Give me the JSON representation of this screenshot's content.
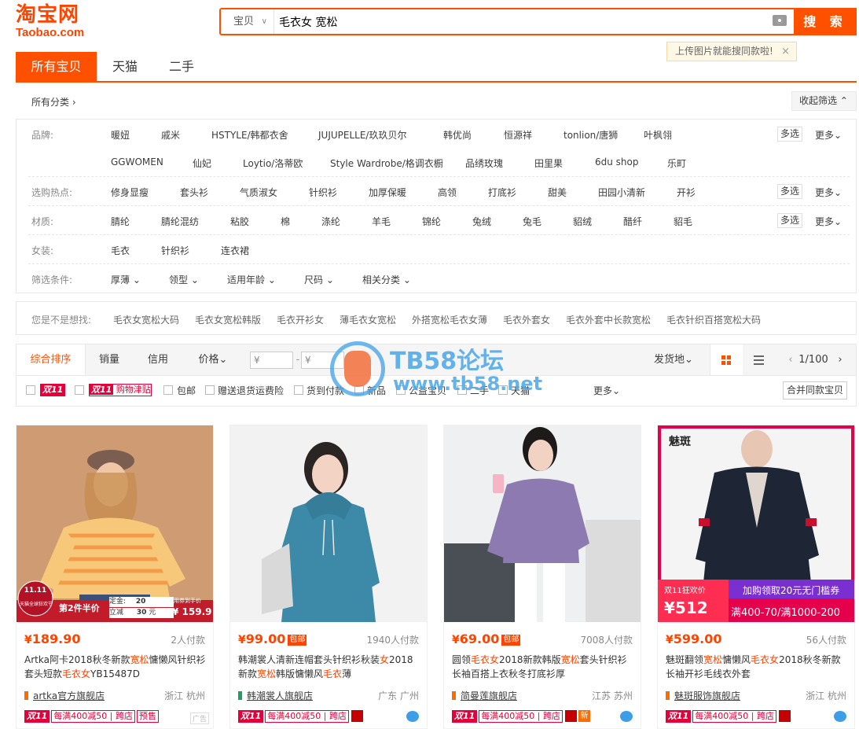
{
  "logo": {
    "cn": "淘宝网",
    "en": "Taobao.com"
  },
  "search": {
    "scope": "宝贝",
    "query": "毛衣女 宽松",
    "button": "搜 索",
    "tip": "上传图片就能搜同款啦!"
  },
  "tabs": [
    "所有宝贝",
    "天猫",
    "二手"
  ],
  "crumb": "所有分类 ›",
  "fold_button": "收起筛选 ⌃",
  "filters": {
    "brand_label": "品牌:",
    "brand_row1": [
      "暖妞",
      "戚米",
      "HSTYLE/韩都衣舍",
      "JUJUPELLE/玖玖贝尔",
      "韩优尚",
      "恒源祥",
      "tonlion/唐狮",
      "叶枫翎"
    ],
    "brand_row2": [
      "GGWOMEN",
      "仙妃",
      "Loytio/洛蒂欧",
      "Style Wardrobe/格调衣橱",
      "品绣玫瑰",
      "田里果",
      "6du shop",
      "乐町"
    ],
    "hot_label": "选购热点:",
    "hot": [
      "修身显瘦",
      "套头衫",
      "气质淑女",
      "针织衫",
      "加厚保暖",
      "高领",
      "打底衫",
      "甜美",
      "田园小清新",
      "开衫"
    ],
    "material_label": "材质:",
    "material": [
      "腈纶",
      "腈纶混纺",
      "粘胶",
      "棉",
      "涤纶",
      "羊毛",
      "锦纶",
      "兔绒",
      "兔毛",
      "貂绒",
      "醋纤",
      "貂毛"
    ],
    "women_label": "女装:",
    "women": [
      "毛衣",
      "针织衫",
      "连衣裙"
    ],
    "cond_label": "筛选条件:",
    "cond": [
      "厚薄 ⌄",
      "领型 ⌄",
      "适用年龄 ⌄",
      "尺码 ⌄",
      "相关分类 ⌄"
    ],
    "multi": "多选",
    "more": "更多⌄"
  },
  "suggest": {
    "label": "您是不是想找:",
    "items": [
      "毛衣女宽松大码",
      "毛衣女宽松韩版",
      "毛衣开衫女",
      "薄毛衣女宽松",
      "外搭宽松毛衣女薄",
      "毛衣外套女",
      "毛衣外套中长款宽松",
      "毛衣针织百搭宽松大码"
    ]
  },
  "sort": {
    "items": [
      "综合排序",
      "销量",
      "信用",
      "价格⌄"
    ],
    "price_from": "¥",
    "price_to": "¥",
    "dash": "-",
    "ship": "发货地⌄",
    "page": "1/100",
    "page_prev": "‹",
    "page_next": "›"
  },
  "checks": {
    "d11": "双11",
    "d11_coupon_tag": "双11",
    "d11_coupon": "购物津贴",
    "labels": [
      "包邮",
      "赠送退货运费险",
      "货到付款",
      "新品",
      "公益宝贝",
      "二手",
      "天猫"
    ],
    "more": "更多⌄",
    "merge": "合并同款宝贝"
  },
  "watermark": {
    "title": "TB58论坛",
    "url": "www.tb58.net"
  },
  "products": [
    {
      "price": "189.90",
      "baoyou": "",
      "deals": "2人付款",
      "title": "Artka阿卡2018秋冬新款宽松慵懒风针织衫套头短款毛衣女YB15487D",
      "shop": "artka官方旗舰店",
      "loc": "浙江 杭州",
      "promo": "每满400减50",
      "badge": "跨店",
      "badge2": "预售",
      "ad": "广告",
      "overlay": {
        "tag": "第2件半价",
        "deposit_label": "定金:",
        "deposit": "20",
        "cut_label": "立减",
        "cut": "30",
        "unit": "元",
        "final_label": "用券到手价",
        "final": "¥ 159.9",
        "seal": "11.11",
        "seal_sub": "天猫全球狂欢节"
      }
    },
    {
      "price": "99.00",
      "baoyou": "包邮",
      "deals": "1940人付款",
      "title": "韩潮裳人清新连帽套头针织衫秋装女2018新款宽松韩版慵懒风毛衣薄",
      "shop": "韩潮裳人旗舰店",
      "loc": "广东 广州",
      "promo": "每满400减50",
      "badge": "跨店"
    },
    {
      "price": "69.00",
      "baoyou": "包邮",
      "deals": "7008人付款",
      "title": "圆领毛衣女2018新款韩版宽松套头针织衫长袖百搭上衣秋冬打底衫厚",
      "shop": "简曼莲旗舰店",
      "loc": "江苏 苏州",
      "promo": "每满400减50",
      "badge": "跨店",
      "xin": "新"
    },
    {
      "price": "599.00",
      "baoyou": "",
      "deals": "56人付款",
      "title": "魅斑翻领宽松慵懒风毛衣女2018秋冬新款长袖开衫毛线衣外套",
      "shop": "魅斑服饰旗舰店",
      "loc": "浙江 杭州",
      "promo": "每满400减50",
      "badge": "跨店",
      "overlay": {
        "brand": "魅斑",
        "promo_label": "双11狂欢价",
        "promo_price": "¥512",
        "banner1": "加购领取20元无门槛券",
        "banner2": "满400-70/满1000-200"
      }
    }
  ],
  "colors": {
    "accent": "#ff5000",
    "price": "#ff4400",
    "d11": "#e4003a"
  }
}
